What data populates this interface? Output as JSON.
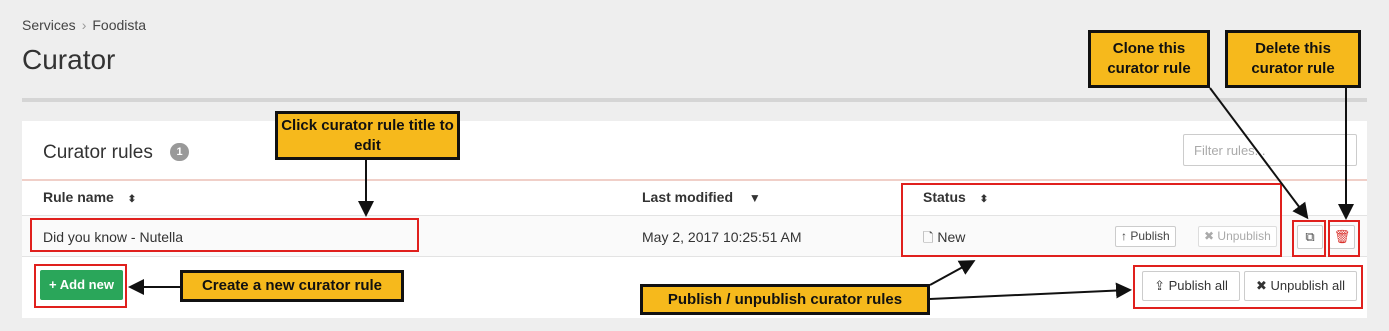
{
  "breadcrumb": {
    "item1": "Services",
    "separator": "›",
    "item2": "Foodista"
  },
  "page": {
    "title": "Curator"
  },
  "panel": {
    "title": "Curator rules",
    "count": "1",
    "filter_placeholder": "Filter rules..."
  },
  "table": {
    "headers": {
      "rule_name": "Rule name",
      "last_modified": "Last modified",
      "status": "Status"
    },
    "sort_icons": {
      "rule_name": "⬍",
      "last_modified": "▼",
      "status": "⬍"
    },
    "rows": [
      {
        "name": "Did you know - Nutella",
        "modified": "May 2, 2017 10:25:51 AM",
        "status": "New",
        "status_icon": "🗋",
        "publish_label": "Publish",
        "publish_icon": "↑",
        "unpublish_label": "Unpublish",
        "unpublish_icon": "✖",
        "clone_icon": "⧉",
        "delete_icon": "🗑"
      }
    ]
  },
  "footer": {
    "add_new_label": "Add new",
    "add_icon": "+",
    "publish_all_label": "Publish all",
    "publish_all_icon": "⇪",
    "unpublish_all_label": "Unpublish all",
    "unpublish_all_icon": "✖"
  },
  "callouts": {
    "edit": "Click curator rule title to edit",
    "clone": "Clone this curator rule",
    "delete": "Delete this curator rule",
    "create": "Create a new curator rule",
    "publish": "Publish / unpublish curator rules"
  },
  "colors": {
    "accent_green": "#2aa65a",
    "callout_yellow": "#f6b91c",
    "highlight_red": "#e0201d",
    "delete_red": "#d9312b"
  }
}
